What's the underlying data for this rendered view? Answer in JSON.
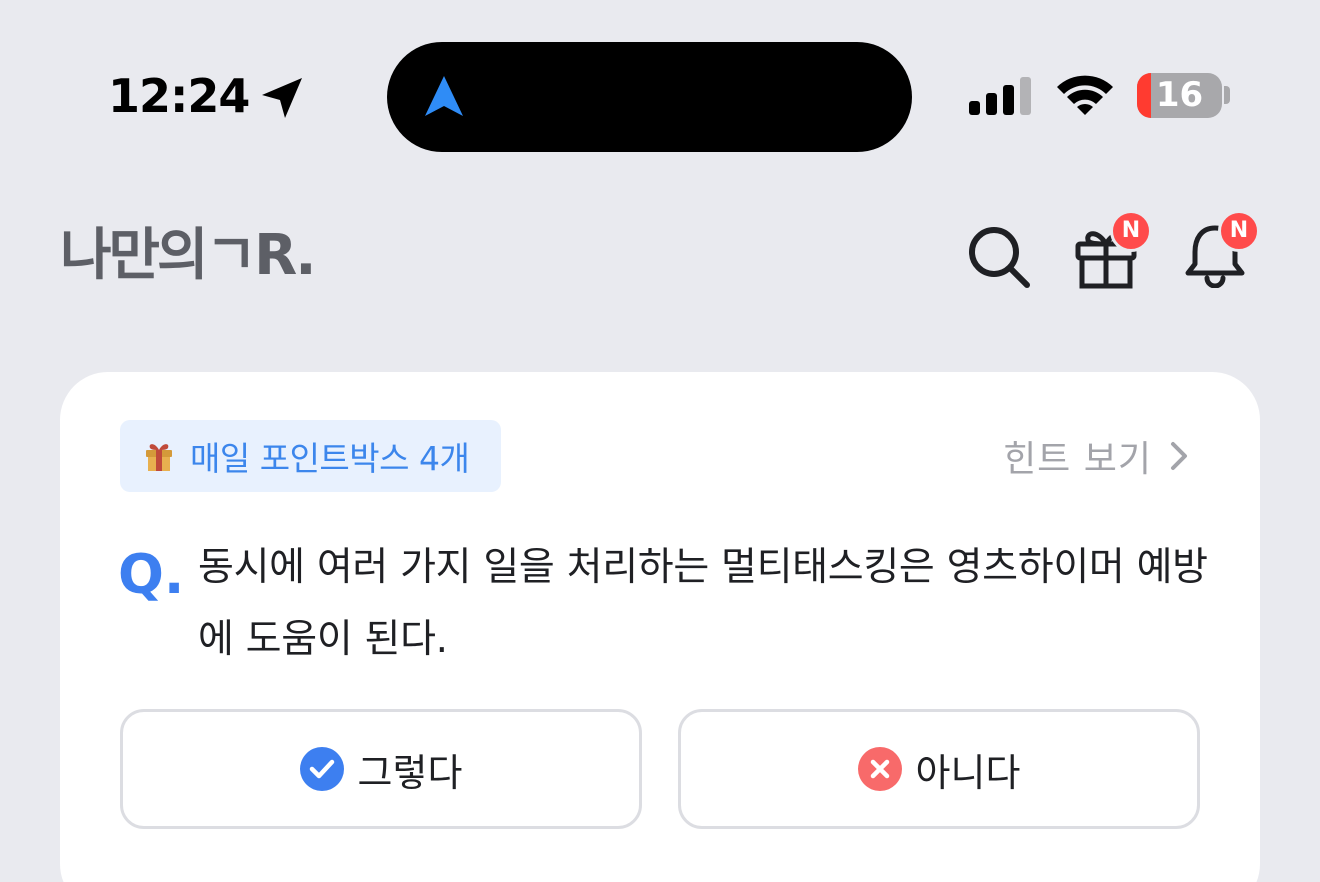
{
  "status_bar": {
    "time": "12:24",
    "battery_level": "16",
    "battery_percent": 16,
    "location_icon": "location-arrow-icon",
    "signal_icon": "cellular-signal-icon",
    "wifi_icon": "wifi-icon",
    "island_icon": "navigation-arrow-icon"
  },
  "header": {
    "logo": "나만의ㄱR.",
    "search_icon": "search-icon",
    "gift_icon": "gift-icon",
    "bell_icon": "bell-icon",
    "gift_badge": "N",
    "bell_badge": "N"
  },
  "quiz": {
    "points_badge": "매일 포인트박스 4개",
    "points_icon": "gift-emoji-icon",
    "hint_label": "힌트 보기",
    "question_mark": "Q.",
    "question": "동시에 여러 가지 일을 처리하는 멀티태스킹은 영츠하이머 예방에 도움이 된다.",
    "answers": [
      {
        "label": "그렇다",
        "icon": "check-circle-icon"
      },
      {
        "label": "아니다",
        "icon": "x-circle-icon"
      }
    ]
  },
  "colors": {
    "background": "#e9eaef",
    "accent_blue": "#3d7ff0",
    "badge_red": "#ff4b4b",
    "wrong_red": "#f86a6a",
    "battery_red": "#ff3b30"
  }
}
